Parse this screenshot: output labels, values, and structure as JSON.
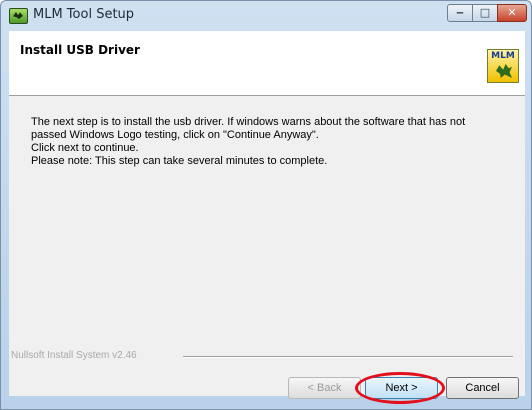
{
  "window": {
    "title": "MLM Tool Setup",
    "controls": {
      "minimize": "‒",
      "maximize": "□",
      "close": "✕"
    }
  },
  "header": {
    "title": "Install USB Driver",
    "logo_text": "MLM"
  },
  "body": {
    "lines": [
      "The next step is to install the usb driver. If windows warns about the software that has not",
      "passed Windows Logo testing, click on \"Continue Anyway\".",
      "Click next to continue.",
      "Please note: This step can take several minutes to complete."
    ]
  },
  "footer": {
    "branding": "Nullsoft Install System v2.46",
    "back_label": "< Back",
    "next_label": "Next >",
    "cancel_label": "Cancel"
  },
  "colors": {
    "highlight": "#e3101b",
    "titlebar": "#b9d1ea"
  }
}
